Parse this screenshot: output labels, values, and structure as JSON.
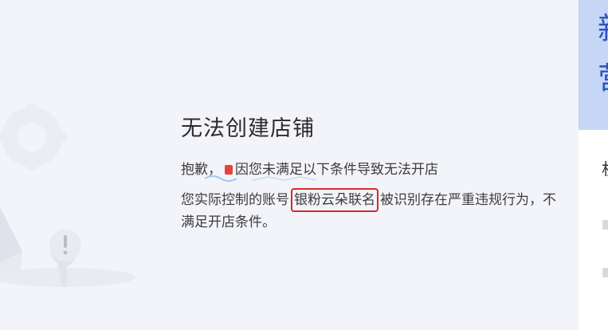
{
  "dialog": {
    "title": "无法创建店铺",
    "reason_prefix": "抱歉，",
    "reason_suffix": "因您未满足以下条件导致无法开店",
    "detail_before": "您实际控制的账号",
    "account_name": "银粉云朵联名",
    "detail_after": "被识别存在严重违规行为，不满足开店条件。"
  },
  "side_panel": {
    "heading_char_1": "新",
    "heading_char_2": "营",
    "text": "机"
  },
  "colors": {
    "highlight_border": "#d42a2a",
    "side_accent": "#c6d6f7"
  },
  "icons": {
    "illustration": "warning-illustration"
  }
}
